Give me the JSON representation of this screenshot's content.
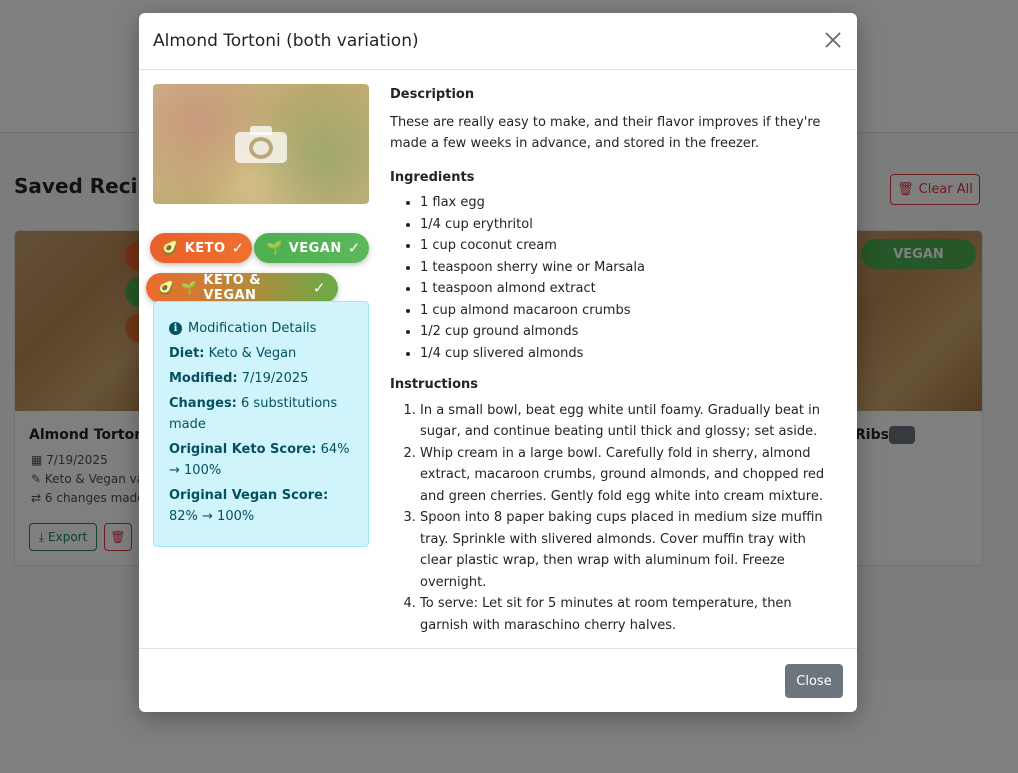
{
  "background": {
    "section_title": "Saved Recipe",
    "clear_all": "Clear All",
    "card1": {
      "title": "Almond Tortoni",
      "date": "7/19/2025",
      "diet": "Keto & Vegan va",
      "changes": "6 changes made",
      "export": "Export"
    },
    "card2": {
      "title": "Ribs",
      "vegan_pill": "VEGAN"
    }
  },
  "modal": {
    "title": "Almond Tortoni (both variation)",
    "pills": {
      "keto": "KETO",
      "vegan": "VEGAN",
      "both": "KETO & VEGAN",
      "check": "✓"
    },
    "modification": {
      "heading": "Modification Details",
      "diet_label": "Diet:",
      "diet_value": "Keto & Vegan",
      "modified_label": "Modified:",
      "modified_value": "7/19/2025",
      "changes_label": "Changes:",
      "changes_value": "6 substitutions made",
      "keto_label": "Original Keto Score:",
      "keto_value": "64% → 100%",
      "vegan_label": "Original Vegan Score:",
      "vegan_value": "82% → 100%"
    },
    "description_heading": "Description",
    "description": "These are really easy to make, and their flavor improves if they're made a few weeks in advance, and stored in the freezer.",
    "ingredients_heading": "Ingredients",
    "ingredients": [
      "1 flax egg",
      "1/4 cup erythritol",
      "1 cup coconut cream",
      "1 teaspoon sherry wine or Marsala",
      "1 teaspoon almond extract",
      "1 cup almond macaroon crumbs",
      "1/2 cup ground almonds",
      "1/4 cup slivered almonds"
    ],
    "instructions_heading": "Instructions",
    "instructions": [
      "In a small bowl, beat egg white until foamy. Gradually beat in sugar, and continue beating until thick and glossy; set aside.",
      "Whip cream in a large bowl. Carefully fold in sherry, almond extract, macaroon crumbs, ground almonds, and chopped red and green cherries. Gently fold egg white into cream mixture.",
      "Spoon into 8 paper baking cups placed in medium size muffin tray. Sprinkle with slivered almonds. Cover muffin tray with clear plastic wrap, then wrap with aluminum foil. Freeze overnight.",
      "To serve: Let sit for 5 minutes at room temperature, then garnish with maraschino cherry halves."
    ],
    "close_button": "Close"
  }
}
